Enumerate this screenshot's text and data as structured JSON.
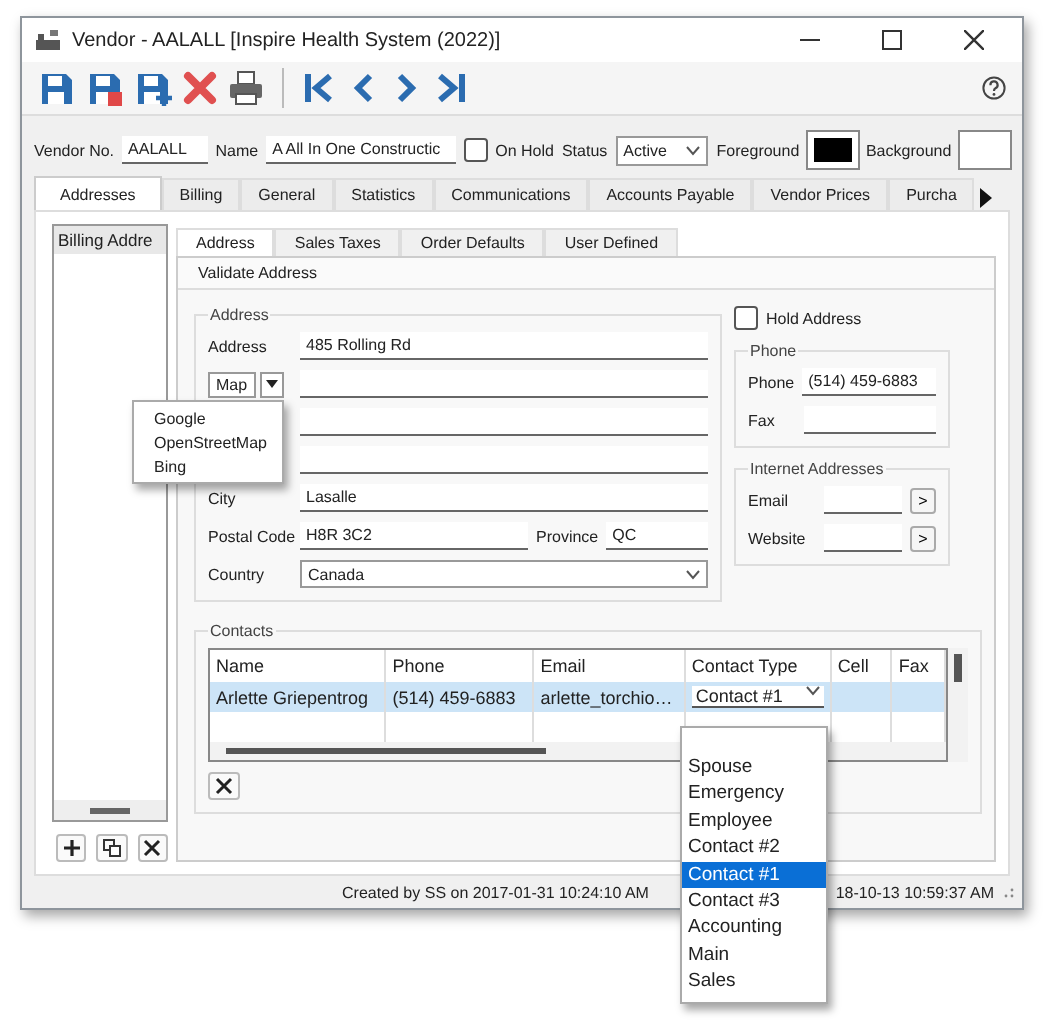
{
  "window": {
    "title": "Vendor - AALALL [Inspire Health System (2022)]"
  },
  "header": {
    "vendor_no_label": "Vendor No.",
    "vendor_no": "AALALL",
    "name_label": "Name",
    "name": "A All In One Constructic",
    "on_hold": {
      "label": "On Hold",
      "checked": false
    },
    "status_label": "Status",
    "status": "Active",
    "foreground": {
      "label": "Foreground",
      "color": "#000000"
    },
    "background": {
      "label": "Background",
      "color": "#ffffff"
    }
  },
  "tabs": [
    {
      "label": "Addresses",
      "selected": true
    },
    {
      "label": "Billing",
      "selected": false
    },
    {
      "label": "General",
      "selected": false
    },
    {
      "label": "Statistics",
      "selected": false
    },
    {
      "label": "Communications",
      "selected": false
    },
    {
      "label": "Accounts Payable",
      "selected": false
    },
    {
      "label": "Vendor Prices",
      "selected": false
    },
    {
      "label": "Purcha",
      "selected": false
    }
  ],
  "address_list": {
    "items": [
      {
        "label": "Billing Addre",
        "selected": true
      }
    ]
  },
  "sub_tabs": [
    {
      "label": "Address",
      "selected": true
    },
    {
      "label": "Sales Taxes",
      "selected": false
    },
    {
      "label": "Order Defaults",
      "selected": false
    },
    {
      "label": "User Defined",
      "selected": false
    }
  ],
  "validate_button": "Validate Address",
  "address_group": {
    "title": "Address",
    "address_label": "Address",
    "address": "485 Rolling Rd",
    "map_button": "Map",
    "city_label": "City",
    "city": "Lasalle",
    "postal_code_label": "Postal Code",
    "postal_code": "H8R 3C2",
    "province_label": "Province",
    "province": "QC",
    "country_label": "Country",
    "country": "Canada"
  },
  "map_menu": [
    "Google",
    "OpenStreetMap",
    "Bing"
  ],
  "hold_address": {
    "label": "Hold Address",
    "checked": false
  },
  "phone_group": {
    "title": "Phone",
    "phone_label": "Phone",
    "phone": "(514) 459-6883",
    "fax_label": "Fax"
  },
  "internet_group": {
    "title": "Internet Addresses",
    "email_label": "Email",
    "website_label": "Website",
    "go_buttons": [
      ">",
      ">"
    ]
  },
  "contacts": {
    "title": "Contacts",
    "columns": [
      "Name",
      "Phone",
      "Email",
      "Contact Type",
      "Cell",
      "Fax"
    ],
    "rows": [
      {
        "cells": [
          "Arlette Griepentrog",
          "(514) 459-6883",
          "arlette_torchio…",
          "Contact #1"
        ],
        "selected": true
      }
    ]
  },
  "contact_type_dropdown": [
    {
      "label": "Spouse",
      "selected": false
    },
    {
      "label": "Emergency",
      "selected": false
    },
    {
      "label": "Employee",
      "selected": false
    },
    {
      "label": "Contact #2",
      "selected": false
    },
    {
      "label": "Contact #1",
      "selected": true
    },
    {
      "label": "Contact #3",
      "selected": false
    },
    {
      "label": "Accounting",
      "selected": false
    },
    {
      "label": "Main",
      "selected": false
    },
    {
      "label": "Sales",
      "selected": false
    }
  ],
  "status_bar": {
    "created": "Created by SS on 2017-01-31 10:24:10 AM",
    "modified_end": "18-10-13 10:59:37 AM"
  }
}
